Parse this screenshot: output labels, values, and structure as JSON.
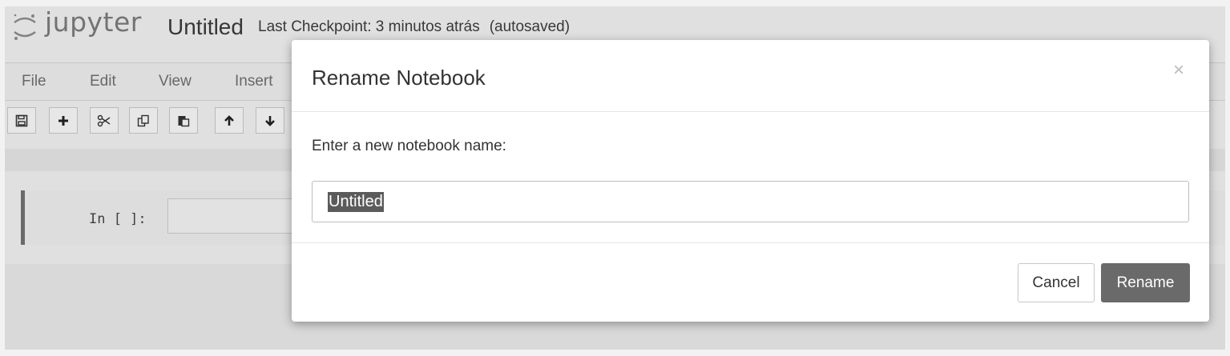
{
  "header": {
    "logo_text": "jupyter",
    "notebook_name": "Untitled",
    "checkpoint": "Last Checkpoint: 3 minutos atrás",
    "autosave": "(autosaved)"
  },
  "menu": {
    "items": [
      "File",
      "Edit",
      "View",
      "Insert"
    ]
  },
  "toolbar": {
    "buttons": [
      {
        "name": "save-icon"
      },
      {
        "name": "plus-icon"
      },
      {
        "name": "scissors-icon"
      },
      {
        "name": "copy-icon"
      },
      {
        "name": "paste-icon"
      },
      {
        "name": "arrow-up-icon"
      },
      {
        "name": "arrow-down-icon"
      }
    ]
  },
  "cell": {
    "prompt": "In [ ]:"
  },
  "modal": {
    "title": "Rename Notebook",
    "close": "×",
    "prompt_label": "Enter a new notebook name:",
    "input_value": "Untitled",
    "cancel_label": "Cancel",
    "rename_label": "Rename"
  },
  "colors": {
    "background": "#ededed",
    "primary_button": "#6a6a6a",
    "selection": "#5b5b5b"
  }
}
